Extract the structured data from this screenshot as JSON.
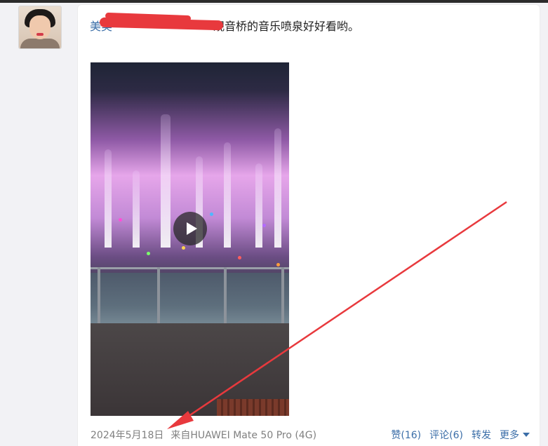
{
  "post": {
    "author": "美美",
    "text": "观音桥的音乐喷泉好好看哟。"
  },
  "video": {
    "play_icon": "play-icon"
  },
  "footer": {
    "date": "2024年5月18日",
    "source": "来自HUAWEI Mate 50 Pro (4G)"
  },
  "actions": {
    "like": "赞(16)",
    "comment": "评论(6)",
    "repost": "转发",
    "more": "更多"
  },
  "colors": {
    "link": "#3b6ea8",
    "annotation_red": "#e8393d"
  }
}
